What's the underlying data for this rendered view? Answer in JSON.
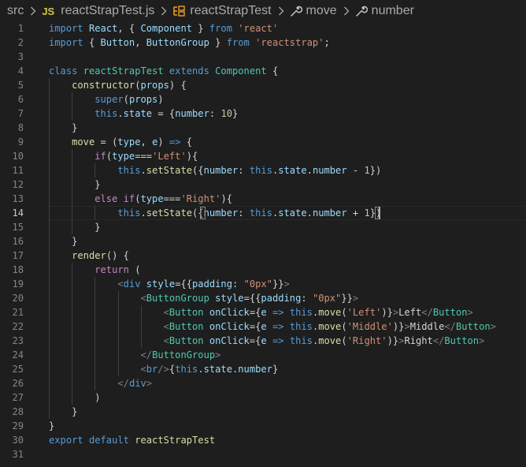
{
  "breadcrumb": {
    "folder": "src",
    "file_icon": "JS",
    "file": "reactStrapTest.js",
    "class_name": "reactStrapTest",
    "method": "move",
    "property": "number"
  },
  "editor": {
    "active_line": 14,
    "lines": [
      {
        "n": "1",
        "tokens": [
          [
            "kw",
            "import"
          ],
          [
            "p",
            " "
          ],
          [
            "var",
            "React"
          ],
          [
            "p",
            ", { "
          ],
          [
            "var",
            "Component"
          ],
          [
            "p",
            " } "
          ],
          [
            "kw",
            "from"
          ],
          [
            "p",
            " "
          ],
          [
            "str",
            "'react'"
          ]
        ]
      },
      {
        "n": "2",
        "tokens": [
          [
            "kw",
            "import"
          ],
          [
            "p",
            " { "
          ],
          [
            "var",
            "Button"
          ],
          [
            "p",
            ", "
          ],
          [
            "var",
            "ButtonGroup"
          ],
          [
            "p",
            " } "
          ],
          [
            "kw",
            "from"
          ],
          [
            "p",
            " "
          ],
          [
            "str",
            "'reactstrap'"
          ],
          [
            "p",
            ";"
          ]
        ]
      },
      {
        "n": "3",
        "tokens": []
      },
      {
        "n": "4",
        "tokens": [
          [
            "kw",
            "class"
          ],
          [
            "p",
            " "
          ],
          [
            "cls",
            "reactStrapTest"
          ],
          [
            "p",
            " "
          ],
          [
            "kw",
            "extends"
          ],
          [
            "p",
            " "
          ],
          [
            "cls",
            "Component"
          ],
          [
            "p",
            " {"
          ]
        ]
      },
      {
        "n": "5",
        "tokens": [
          [
            "p",
            "    "
          ],
          [
            "fn",
            "constructor"
          ],
          [
            "p",
            "("
          ],
          [
            "var",
            "props"
          ],
          [
            "p",
            ") {"
          ]
        ]
      },
      {
        "n": "6",
        "tokens": [
          [
            "p",
            "        "
          ],
          [
            "kw",
            "super"
          ],
          [
            "p",
            "("
          ],
          [
            "var",
            "props"
          ],
          [
            "p",
            ")"
          ]
        ]
      },
      {
        "n": "7",
        "tokens": [
          [
            "p",
            "        "
          ],
          [
            "kw",
            "this"
          ],
          [
            "p",
            "."
          ],
          [
            "var",
            "state"
          ],
          [
            "p",
            " = {"
          ],
          [
            "var",
            "number"
          ],
          [
            "p",
            ": "
          ],
          [
            "num",
            "10"
          ],
          [
            "p",
            "}"
          ]
        ]
      },
      {
        "n": "8",
        "tokens": [
          [
            "p",
            "    }"
          ]
        ]
      },
      {
        "n": "9",
        "tokens": [
          [
            "p",
            "    "
          ],
          [
            "fn",
            "move"
          ],
          [
            "p",
            " = ("
          ],
          [
            "var",
            "type"
          ],
          [
            "p",
            ", "
          ],
          [
            "var",
            "e"
          ],
          [
            "p",
            ") "
          ],
          [
            "kw",
            "=>"
          ],
          [
            "p",
            " {"
          ]
        ]
      },
      {
        "n": "10",
        "tokens": [
          [
            "p",
            "        "
          ],
          [
            "ctrl",
            "if"
          ],
          [
            "p",
            "("
          ],
          [
            "var",
            "type"
          ],
          [
            "p",
            "==="
          ],
          [
            "str",
            "'Left'"
          ],
          [
            "p",
            "){"
          ]
        ]
      },
      {
        "n": "11",
        "tokens": [
          [
            "p",
            "            "
          ],
          [
            "kw",
            "this"
          ],
          [
            "p",
            "."
          ],
          [
            "fn",
            "setState"
          ],
          [
            "p",
            "({"
          ],
          [
            "var",
            "number"
          ],
          [
            "p",
            ": "
          ],
          [
            "kw",
            "this"
          ],
          [
            "p",
            "."
          ],
          [
            "var",
            "state"
          ],
          [
            "p",
            "."
          ],
          [
            "var",
            "number"
          ],
          [
            "p",
            " - "
          ],
          [
            "num",
            "1"
          ],
          [
            "p",
            "})"
          ]
        ]
      },
      {
        "n": "12",
        "tokens": [
          [
            "p",
            "        }"
          ]
        ]
      },
      {
        "n": "13",
        "tokens": [
          [
            "p",
            "        "
          ],
          [
            "ctrl",
            "else"
          ],
          [
            "p",
            " "
          ],
          [
            "ctrl",
            "if"
          ],
          [
            "p",
            "("
          ],
          [
            "var",
            "type"
          ],
          [
            "p",
            "==="
          ],
          [
            "str",
            "'Right'"
          ],
          [
            "p",
            "){"
          ]
        ]
      },
      {
        "n": "14",
        "tokens": [
          [
            "p",
            "            "
          ],
          [
            "kw",
            "this"
          ],
          [
            "p",
            "."
          ],
          [
            "fn",
            "setState"
          ],
          [
            "p",
            "({"
          ],
          [
            "var",
            "number"
          ],
          [
            "p",
            ": "
          ],
          [
            "kw",
            "this"
          ],
          [
            "p",
            "."
          ],
          [
            "var",
            "state"
          ],
          [
            "p",
            "."
          ],
          [
            "var",
            "number"
          ],
          [
            "p",
            " + "
          ],
          [
            "num",
            "1"
          ],
          [
            "p",
            "})"
          ]
        ]
      },
      {
        "n": "15",
        "tokens": [
          [
            "p",
            "        }"
          ]
        ]
      },
      {
        "n": "16",
        "tokens": [
          [
            "p",
            "    }"
          ]
        ]
      },
      {
        "n": "17",
        "tokens": [
          [
            "p",
            "    "
          ],
          [
            "fn",
            "render"
          ],
          [
            "p",
            "() {"
          ]
        ]
      },
      {
        "n": "18",
        "tokens": [
          [
            "p",
            "        "
          ],
          [
            "ctrl",
            "return"
          ],
          [
            "p",
            " ("
          ]
        ]
      },
      {
        "n": "19",
        "tokens": [
          [
            "p",
            "            "
          ],
          [
            "br",
            "<"
          ],
          [
            "kw",
            "div"
          ],
          [
            "p",
            " "
          ],
          [
            "var",
            "style"
          ],
          [
            "p",
            "={{"
          ],
          [
            "var",
            "padding"
          ],
          [
            "p",
            ": "
          ],
          [
            "str",
            "\"0px\""
          ],
          [
            "p",
            "}}"
          ],
          [
            "br",
            ">"
          ]
        ]
      },
      {
        "n": "20",
        "tokens": [
          [
            "p",
            "                "
          ],
          [
            "br",
            "<"
          ],
          [
            "tag",
            "ButtonGroup"
          ],
          [
            "p",
            " "
          ],
          [
            "var",
            "style"
          ],
          [
            "p",
            "={{"
          ],
          [
            "var",
            "padding"
          ],
          [
            "p",
            ": "
          ],
          [
            "str",
            "\"0px\""
          ],
          [
            "p",
            "}}"
          ],
          [
            "br",
            ">"
          ]
        ]
      },
      {
        "n": "21",
        "tokens": [
          [
            "p",
            "                    "
          ],
          [
            "br",
            "<"
          ],
          [
            "tag",
            "Button"
          ],
          [
            "p",
            " "
          ],
          [
            "var",
            "onClick"
          ],
          [
            "p",
            "={"
          ],
          [
            "var",
            "e"
          ],
          [
            "p",
            " "
          ],
          [
            "kw",
            "=>"
          ],
          [
            "p",
            " "
          ],
          [
            "kw",
            "this"
          ],
          [
            "p",
            "."
          ],
          [
            "fn",
            "move"
          ],
          [
            "p",
            "("
          ],
          [
            "str",
            "'Left'"
          ],
          [
            "p",
            ")}"
          ],
          [
            "br",
            ">"
          ],
          [
            "txt",
            "Left"
          ],
          [
            "br",
            "</"
          ],
          [
            "tag",
            "Button"
          ],
          [
            "br",
            ">"
          ]
        ]
      },
      {
        "n": "22",
        "tokens": [
          [
            "p",
            "                    "
          ],
          [
            "br",
            "<"
          ],
          [
            "tag",
            "Button"
          ],
          [
            "p",
            " "
          ],
          [
            "var",
            "onClick"
          ],
          [
            "p",
            "={"
          ],
          [
            "var",
            "e"
          ],
          [
            "p",
            " "
          ],
          [
            "kw",
            "=>"
          ],
          [
            "p",
            " "
          ],
          [
            "kw",
            "this"
          ],
          [
            "p",
            "."
          ],
          [
            "fn",
            "move"
          ],
          [
            "p",
            "("
          ],
          [
            "str",
            "'Middle'"
          ],
          [
            "p",
            ")}"
          ],
          [
            "br",
            ">"
          ],
          [
            "txt",
            "Middle"
          ],
          [
            "br",
            "</"
          ],
          [
            "tag",
            "Button"
          ],
          [
            "br",
            ">"
          ]
        ]
      },
      {
        "n": "23",
        "tokens": [
          [
            "p",
            "                    "
          ],
          [
            "br",
            "<"
          ],
          [
            "tag",
            "Button"
          ],
          [
            "p",
            " "
          ],
          [
            "var",
            "onClick"
          ],
          [
            "p",
            "={"
          ],
          [
            "var",
            "e"
          ],
          [
            "p",
            " "
          ],
          [
            "kw",
            "=>"
          ],
          [
            "p",
            " "
          ],
          [
            "kw",
            "this"
          ],
          [
            "p",
            "."
          ],
          [
            "fn",
            "move"
          ],
          [
            "p",
            "("
          ],
          [
            "str",
            "'Right'"
          ],
          [
            "p",
            ")}"
          ],
          [
            "br",
            ">"
          ],
          [
            "txt",
            "Right"
          ],
          [
            "br",
            "</"
          ],
          [
            "tag",
            "Button"
          ],
          [
            "br",
            ">"
          ]
        ]
      },
      {
        "n": "24",
        "tokens": [
          [
            "p",
            "                "
          ],
          [
            "br",
            "</"
          ],
          [
            "tag",
            "ButtonGroup"
          ],
          [
            "br",
            ">"
          ]
        ]
      },
      {
        "n": "25",
        "tokens": [
          [
            "p",
            "                "
          ],
          [
            "br",
            "<"
          ],
          [
            "kw",
            "br"
          ],
          [
            "br",
            "/>"
          ],
          [
            "p",
            "{"
          ],
          [
            "kw",
            "this"
          ],
          [
            "p",
            "."
          ],
          [
            "var",
            "state"
          ],
          [
            "p",
            "."
          ],
          [
            "var",
            "number"
          ],
          [
            "p",
            "}"
          ]
        ]
      },
      {
        "n": "26",
        "tokens": [
          [
            "p",
            "            "
          ],
          [
            "br",
            "</"
          ],
          [
            "kw",
            "div"
          ],
          [
            "br",
            ">"
          ]
        ]
      },
      {
        "n": "27",
        "tokens": [
          [
            "p",
            "        )"
          ]
        ]
      },
      {
        "n": "28",
        "tokens": [
          [
            "p",
            "    }"
          ]
        ]
      },
      {
        "n": "29",
        "tokens": [
          [
            "p",
            "}"
          ]
        ]
      },
      {
        "n": "30",
        "tokens": [
          [
            "kw",
            "export"
          ],
          [
            "p",
            " "
          ],
          [
            "kw",
            "default"
          ],
          [
            "p",
            " "
          ],
          [
            "fn",
            "reactStrapTest"
          ]
        ]
      },
      {
        "n": "31",
        "tokens": []
      }
    ]
  }
}
